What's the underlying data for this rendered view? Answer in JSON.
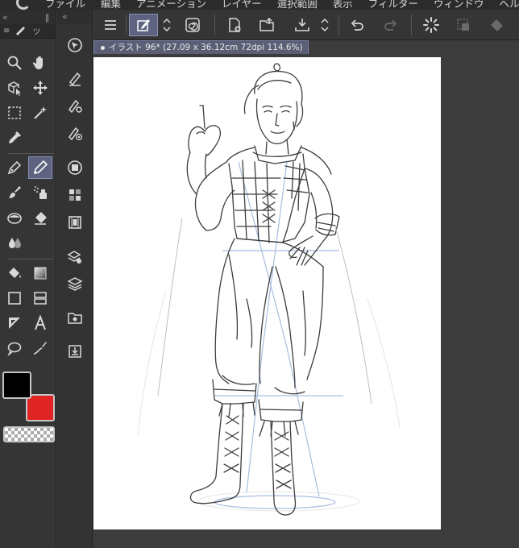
{
  "menu": [
    "ファイル",
    "編集",
    "アニメーション",
    "レイヤー",
    "選択範囲",
    "表示",
    "フィルター",
    "ウィンドウ",
    "ヘルプ"
  ],
  "document": {
    "tab_title": "イラスト 96* (27.09 x 36.12cm 72dpi 114.6%)"
  },
  "palette": {
    "collapse_glyph": "«",
    "handle_glyph": "≡",
    "tab_label": "ツ"
  },
  "colors": {
    "main": "#000000",
    "sub": "#e02323",
    "selection": "#5d6380"
  }
}
